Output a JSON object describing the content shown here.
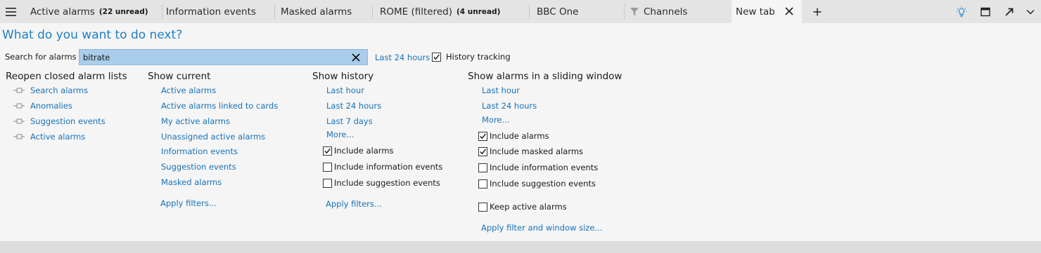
{
  "tabs": [
    {
      "label": "Active alarms",
      "badge": "(22 unread)"
    },
    {
      "label": "Information events",
      "badge": ""
    },
    {
      "label": "Masked alarms",
      "badge": ""
    },
    {
      "label": "ROME (filtered)",
      "badge": "(4 unread)"
    },
    {
      "label": "BBC One",
      "badge": ""
    },
    {
      "label": "Channels",
      "badge": ""
    },
    {
      "label": "New tab",
      "badge": ""
    }
  ],
  "heading": "What do you want to do next?",
  "search": {
    "label": "Search for alarms",
    "value": "bitrate",
    "range_link": "Last 24 hours",
    "history_tracking_label": "History tracking",
    "history_tracking_checked": true
  },
  "reopen": {
    "title": "Reopen closed alarm lists",
    "items": [
      "Search alarms",
      "Anomalies",
      "Suggestion events",
      "Active alarms"
    ]
  },
  "current": {
    "title": "Show current",
    "items": [
      "Active alarms",
      "Active alarms linked to cards",
      "My active alarms",
      "Unassigned active alarms",
      "Information events",
      "Suggestion events",
      "Masked alarms"
    ],
    "apply": "Apply filters..."
  },
  "history": {
    "title": "Show history",
    "links": [
      "Last hour",
      "Last 24 hours",
      "Last 7 days",
      "More..."
    ],
    "options": [
      {
        "label": "Include alarms",
        "checked": true
      },
      {
        "label": "Include information events",
        "checked": false
      },
      {
        "label": "Include suggestion events",
        "checked": false
      }
    ],
    "apply": "Apply filters..."
  },
  "sliding": {
    "title": "Show alarms in a sliding window",
    "links": [
      "Last hour",
      "Last 24 hours",
      "More..."
    ],
    "options": [
      {
        "label": "Include alarms",
        "checked": true
      },
      {
        "label": "Include masked alarms",
        "checked": true
      },
      {
        "label": "Include information events",
        "checked": false
      },
      {
        "label": "Include suggestion events",
        "checked": false
      }
    ],
    "keep_active": {
      "label": "Keep active alarms",
      "checked": false
    },
    "apply": "Apply filter and window size..."
  },
  "icons": {
    "menu": "hamburger-menu-icon",
    "filter": "funnel-icon",
    "close": "close-icon",
    "add": "plus-icon",
    "idea": "lightbulb-icon",
    "maximize": "maximize-window-icon",
    "detach": "pop-out-icon",
    "more": "chevron-down-icon",
    "pin": "pin-icon"
  },
  "colors": {
    "accent": "#1e7fc4",
    "link": "#1872b8",
    "search_bg": "#a9cdea",
    "tabbar_bg": "#e4e4e4",
    "idea_icon": "#2a8fd6"
  }
}
